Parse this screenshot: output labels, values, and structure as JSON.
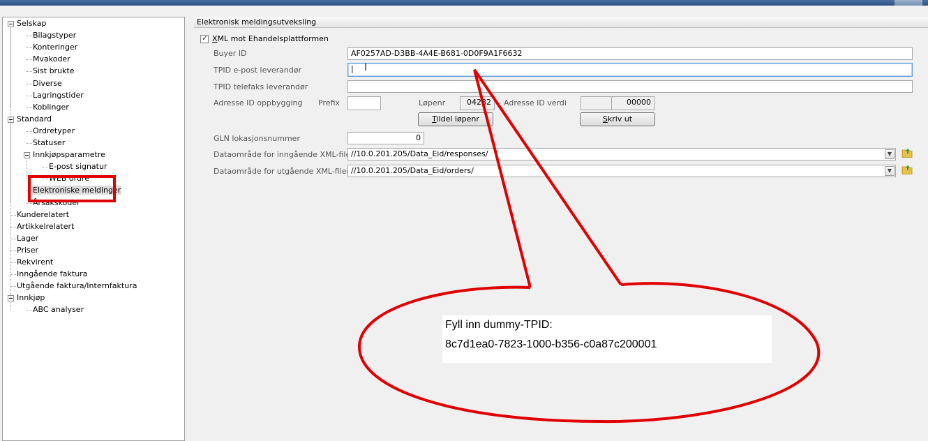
{
  "tree": {
    "items": [
      {
        "label": "Selskap",
        "level": 0,
        "toggle": "collapse"
      },
      {
        "label": "Bilagstyper",
        "level": 1
      },
      {
        "label": "Konteringer",
        "level": 1
      },
      {
        "label": "Mvakoder",
        "level": 1
      },
      {
        "label": "Sist brukte",
        "level": 1
      },
      {
        "label": "Diverse",
        "level": 1
      },
      {
        "label": "Lagringstider",
        "level": 1
      },
      {
        "label": "Koblinger",
        "level": 1
      },
      {
        "label": "Standard",
        "level": 0,
        "toggle": "collapse"
      },
      {
        "label": "Ordretyper",
        "level": 1
      },
      {
        "label": "Statuser",
        "level": 1
      },
      {
        "label": "Innkjøpsparametre",
        "level": 1,
        "toggle": "collapse"
      },
      {
        "label": "E-post signatur",
        "level": 2
      },
      {
        "label": "WEB ordre",
        "level": 2
      },
      {
        "label": "Elektroniske meldinger",
        "level": 1,
        "selected": true
      },
      {
        "label": "Årsakskoder",
        "level": 1
      },
      {
        "label": "Kunderelatert",
        "level": 0
      },
      {
        "label": "Artikkelrelatert",
        "level": 0
      },
      {
        "label": "Lager",
        "level": 0
      },
      {
        "label": "Priser",
        "level": 0
      },
      {
        "label": "Rekvirent",
        "level": 0
      },
      {
        "label": "Inngående faktura",
        "level": 0
      },
      {
        "label": "Utgående faktura/Internfaktura",
        "level": 0
      },
      {
        "label": "Innkjøp",
        "level": 0,
        "toggle": "collapse"
      },
      {
        "label": "ABC analyser",
        "level": 1
      }
    ]
  },
  "panel": {
    "header": "Elektronisk meldingsutveksling",
    "xml_checkbox_label": "XML mot Ehandelsplattformen",
    "xml_checkbox_checked": true,
    "buyer_id_label": "Buyer ID",
    "buyer_id_value": "AF0257AD-D3BB-4A4E-B681-0D0F9A1F6632",
    "tpid_email_label": "TPID e-post leverandør",
    "tpid_email_value": "|",
    "tpid_fax_label": "TPID telefaks leverandør",
    "tpid_fax_value": "",
    "adresse_label": "Adresse ID oppbygging",
    "prefix_label": "Prefix",
    "prefix_value": "",
    "lopenr_label": "Løpenr",
    "lopenr_value": "04282",
    "adresse_verdi_label": "Adresse ID verdi",
    "adresse_verdi_value": "00000",
    "tildel_button": {
      "underline": "T",
      "rest": "ildel løpenr"
    },
    "skriv_button": {
      "underline": "S",
      "rest": "kriv ut"
    },
    "gln_label": "GLN lokasjonsnummer",
    "gln_value": "0",
    "inn_label": "Dataområde for inngående XML-filer",
    "inn_value": "//10.0.201.205/Data_Eid/responses/",
    "ut_label": "Dataområde for utgående XML-filer",
    "ut_value": "//10.0.201.205/Data_Eid/orders/"
  },
  "callout": {
    "line1": "Fyll inn dummy-TPID:",
    "line2": "8c7d1ea0-7823-1000-b356-c0a87c200001"
  },
  "colors": {
    "annotation_red": "#e00000",
    "focus_blue": "#5b9bd5"
  },
  "icons": {
    "combo": "chevron-down-icon",
    "folder": "folder-up-icon"
  }
}
